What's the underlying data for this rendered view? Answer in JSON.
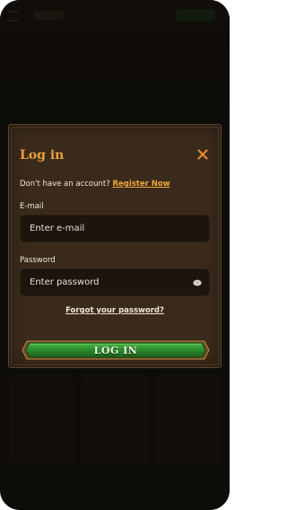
{
  "modal": {
    "title": "Log in",
    "no_account_text": "Don't have an account?",
    "register_link": "Register Now",
    "email_label": "E-mail",
    "email_placeholder": "Enter e-mail",
    "password_label": "Password",
    "password_placeholder": "Enter password",
    "forgot_link": "Forgot your password?",
    "login_button": "LOG IN"
  },
  "colors": {
    "accent": "#e9a03b",
    "button_green": "#2a8a2a",
    "modal_bg": "#3a2a1b",
    "input_bg": "#1c140d"
  },
  "icons": {
    "close": "close-icon",
    "password_toggle": "eye-icon"
  }
}
